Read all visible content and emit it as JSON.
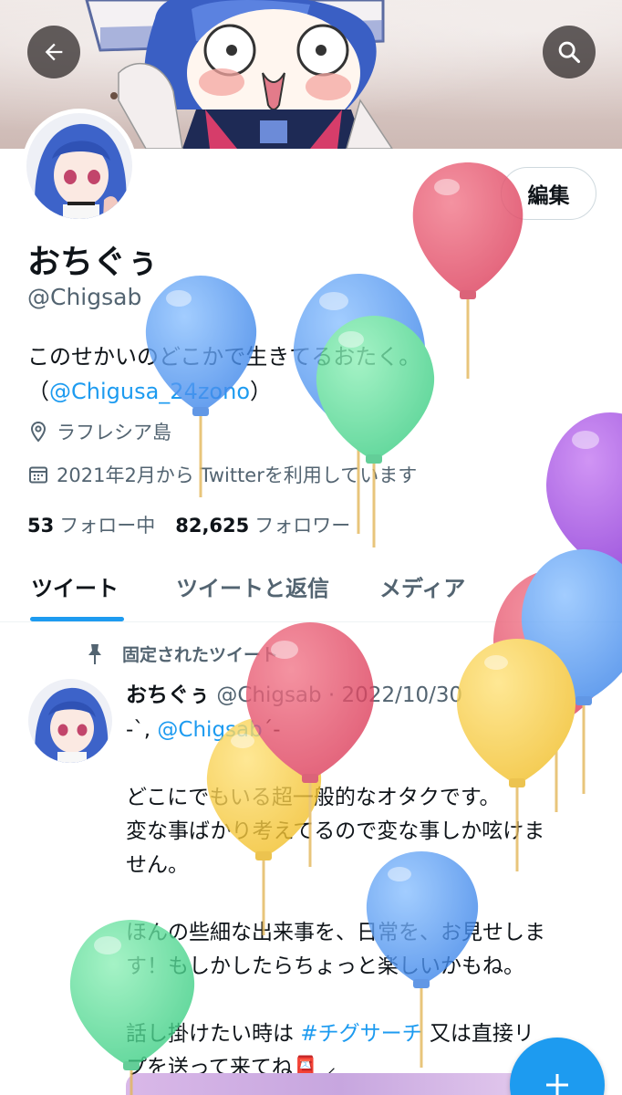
{
  "header": {
    "back_icon": "arrow-left-icon",
    "search_icon": "search-icon"
  },
  "profile": {
    "display_name": "おちぐぅ",
    "handle": "@Chigsab",
    "edit_label": "編集",
    "bio_line1": "このせかいのどこかで生きてるおたく。",
    "bio_line2_open": "（",
    "bio_link": "@Chigusa_24zono",
    "bio_line2_close": "）",
    "location": "ラフレシア島",
    "joined": "2021年2月から Twitterを利用しています",
    "following_count": "53",
    "following_label": "フォロー中",
    "followers_count": "82,625",
    "followers_label": "フォロワー"
  },
  "tabs": [
    "ツイート",
    "ツイートと返信",
    "メディア"
  ],
  "pinned_tweet": {
    "pinned_label": "固定されたツイート",
    "author_name": "おちぐぅ",
    "author_meta": "@Chigsab · 2022/10/30",
    "line1_pre": "-`, ",
    "line1_link": "@Chigsab",
    "line1_post": "´-",
    "line2": "どこにでもいる超一般的なオタクです。",
    "line3": "変な事ばかり考えてるので変な事しか呟けま",
    "line4": "せん。",
    "line5": "ほんの些細な出来事を、日常を、お見せしま",
    "line6": "す！もしかしたらちょっと楽しいかもね。",
    "line7_pre": "話し掛けたい時は ",
    "line7_link": "#チグサーチ",
    "line7_post": " 又は直接リ",
    "line8": "プを送って来てね📮 ⸝"
  },
  "fab": {
    "icon": "plus-icon"
  },
  "colors": {
    "accent": "#1d9bf0",
    "text": "#0f1419",
    "muted": "#536471"
  }
}
